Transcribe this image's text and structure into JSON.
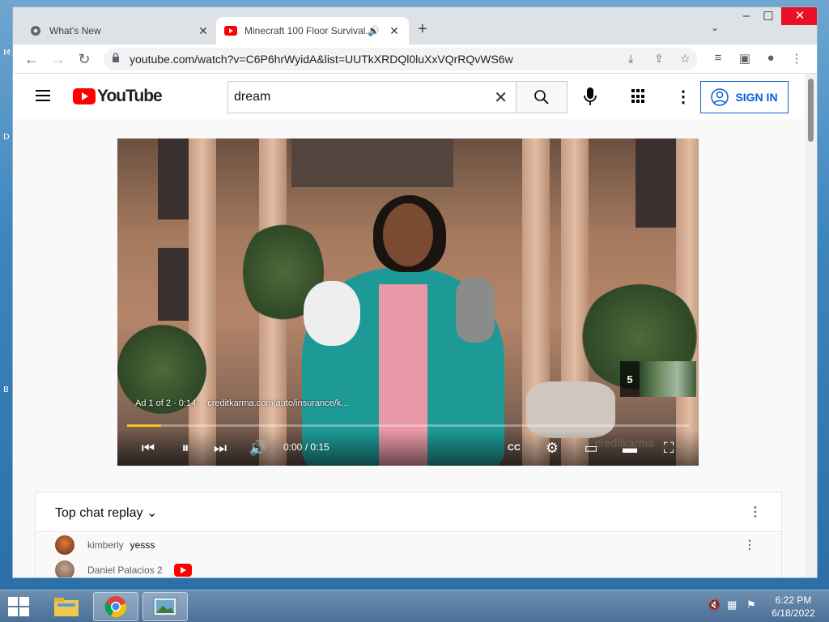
{
  "desktop": {
    "side_letters": [
      "M",
      "D",
      "B"
    ]
  },
  "browser": {
    "tabs": [
      {
        "label": "What's New",
        "active": false
      },
      {
        "label": "Minecraft 100 Floor Survival...",
        "active": true,
        "audio": true
      }
    ],
    "url": "youtube.com/watch?v=C6P6hrWyidA&list=UUTkXRDQl0luXxVQrRQvWS6w"
  },
  "youtube": {
    "logo_text": "YouTube",
    "search": {
      "value": "dream"
    },
    "sign_in_label": "SIGN IN",
    "player": {
      "ad_label": "Ad 1 of 2 · 0:14",
      "ad_url": "creditkarma.com/auto/insurance/k...",
      "next_count": "5",
      "time": "0:00 / 0:15",
      "progress_fraction": 0.06,
      "watermark": "creditkarma",
      "accent_color": "#fbc02d"
    },
    "chat": {
      "title": "Top chat replay",
      "messages": [
        {
          "author": "kimberly",
          "text": "yesss"
        },
        {
          "author": "Daniel Palacios 2",
          "text": ""
        }
      ]
    }
  },
  "taskbar": {
    "clock_time": "6:22 PM",
    "clock_date": "6/18/2022"
  }
}
